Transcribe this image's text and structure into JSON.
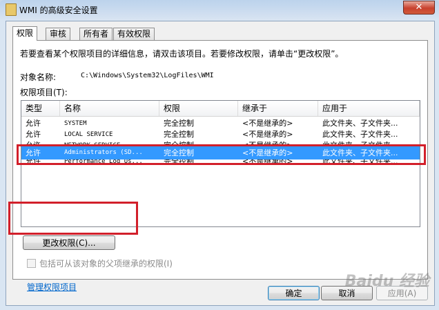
{
  "window": {
    "title": "WMI 的高级安全设置",
    "close": "✕"
  },
  "tabs": [
    {
      "label": "权限"
    },
    {
      "label": "审核"
    },
    {
      "label": "所有者"
    },
    {
      "label": "有效权限"
    }
  ],
  "panel": {
    "info": "若要查看某个权限项目的详细信息，请双击该项目。若要修改权限，请单击“更改权限”。",
    "object_label": "对象名称:",
    "object_value": "C:\\Windows\\System32\\LogFiles\\WMI",
    "items_label": "权限项目(T):"
  },
  "list": {
    "columns": [
      "类型",
      "名称",
      "权限",
      "继承于",
      "应用于"
    ],
    "rows": [
      {
        "type": "允许",
        "name": "SYSTEM",
        "perm": "完全控制",
        "inherit": "<不是继承的>",
        "apply": "此文件夹、子文件夹..."
      },
      {
        "type": "允许",
        "name": "LOCAL SERVICE",
        "perm": "完全控制",
        "inherit": "<不是继承的>",
        "apply": "此文件夹、子文件夹..."
      },
      {
        "type": "允许",
        "name": "NETWORK SERVICE",
        "perm": "完全控制",
        "inherit": "<不是继承的>",
        "apply": "此文件夹、子文件夹..."
      },
      {
        "type": "允许",
        "name": "Administrators (SD...",
        "perm": "完全控制",
        "inherit": "<不是继承的>",
        "apply": "此文件夹、子文件夹..."
      },
      {
        "type": "允许",
        "name": "Performance Log Us...",
        "perm": "完全控制",
        "inherit": "<不是继承的>",
        "apply": "此文件夹、子文件夹..."
      }
    ]
  },
  "buttons": {
    "change": "更改权限(C)...",
    "ok": "确定",
    "cancel": "取消",
    "apply": "应用(A)"
  },
  "checkbox": {
    "label": "包括可从该对象的父项继承的权限(I)"
  },
  "link": {
    "label": "管理权限项目"
  },
  "watermark": "Baidu 经验"
}
